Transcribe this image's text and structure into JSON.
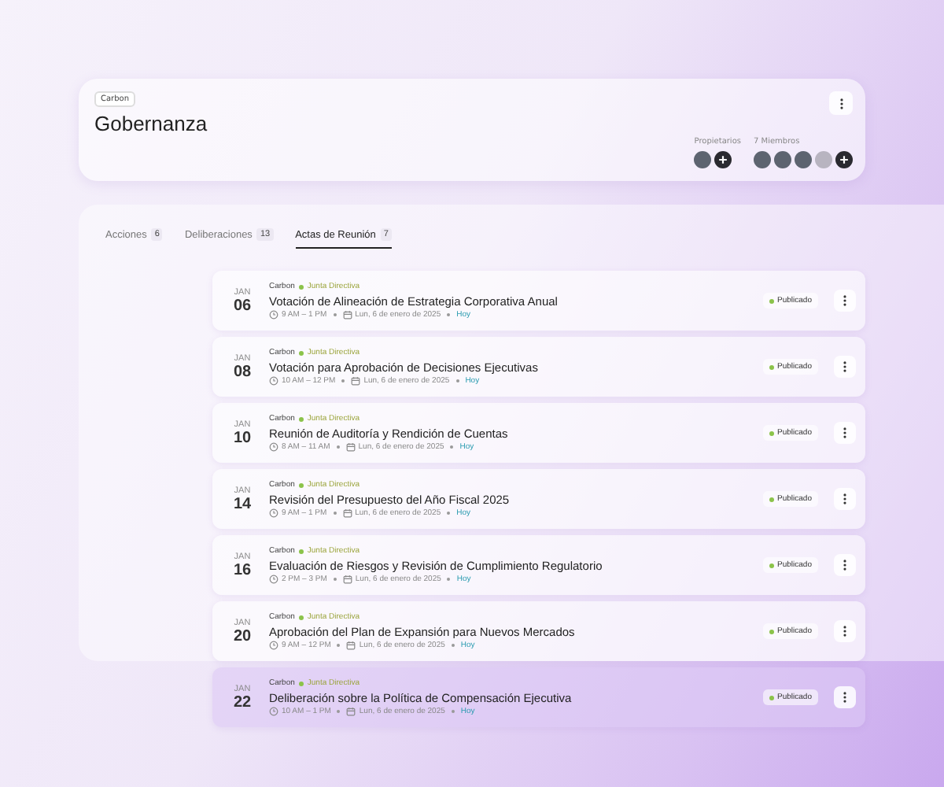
{
  "header": {
    "tag": "Carbon",
    "title": "Gobernanza",
    "owners": {
      "label": "Propietarios",
      "avatars": [
        {
          "kind": "photo"
        }
      ]
    },
    "members": {
      "label": "7 Miembros",
      "avatars": [
        {
          "kind": "photo"
        },
        {
          "kind": "photo"
        },
        {
          "kind": "photo"
        },
        {
          "kind": "blank"
        }
      ]
    }
  },
  "tabs": [
    {
      "label": "Acciones",
      "count": "6",
      "selected": false
    },
    {
      "label": "Deliberaciones",
      "count": "13",
      "selected": false
    },
    {
      "label": "Actas de Reunión",
      "count": "7",
      "selected": true
    }
  ],
  "meetings": [
    {
      "month": "JAN",
      "day": "06",
      "org": "Carbon",
      "group": "Junta Directiva",
      "title": "Votación de Alineación de Estrategia Corporativa Anual",
      "time": "9 AM – 1 PM",
      "date": "Lun, 6 de enero de 2025",
      "when": "Hoy",
      "status": "Publicado",
      "selected": false
    },
    {
      "month": "JAN",
      "day": "08",
      "org": "Carbon",
      "group": "Junta Directiva",
      "title": "Votación para Aprobación de Decisiones Ejecutivas",
      "time": "10 AM – 12 PM",
      "date": "Lun, 6 de enero de 2025",
      "when": "Hoy",
      "status": "Publicado",
      "selected": false
    },
    {
      "month": "JAN",
      "day": "10",
      "org": "Carbon",
      "group": "Junta Directiva",
      "title": "Reunión de Auditoría y Rendición de Cuentas",
      "time": "8 AM – 11 AM",
      "date": "Lun, 6 de enero de 2025",
      "when": "Hoy",
      "status": "Publicado",
      "selected": false
    },
    {
      "month": "JAN",
      "day": "14",
      "org": "Carbon",
      "group": "Junta Directiva",
      "title": "Revisión del Presupuesto del Año Fiscal 2025",
      "time": "9 AM – 1 PM",
      "date": "Lun, 6 de enero de 2025",
      "when": "Hoy",
      "status": "Publicado",
      "selected": false
    },
    {
      "month": "JAN",
      "day": "16",
      "org": "Carbon",
      "group": "Junta Directiva",
      "title": "Evaluación de Riesgos y Revisión de Cumplimiento Regulatorio",
      "time": "2 PM – 3 PM",
      "date": "Lun, 6 de enero de 2025",
      "when": "Hoy",
      "status": "Publicado",
      "selected": false
    },
    {
      "month": "JAN",
      "day": "20",
      "org": "Carbon",
      "group": "Junta Directiva",
      "title": "Aprobación del Plan de Expansión para Nuevos Mercados",
      "time": "9 AM – 12 PM",
      "date": "Lun, 6 de enero de 2025",
      "when": "Hoy",
      "status": "Publicado",
      "selected": false
    },
    {
      "month": "JAN",
      "day": "22",
      "org": "Carbon",
      "group": "Junta Directiva",
      "title": "Deliberación sobre la Política de Compensación Ejecutiva",
      "time": "10 AM – 1 PM",
      "date": "Lun, 6 de enero de 2025",
      "when": "Hoy",
      "status": "Publicado",
      "selected": true
    }
  ]
}
